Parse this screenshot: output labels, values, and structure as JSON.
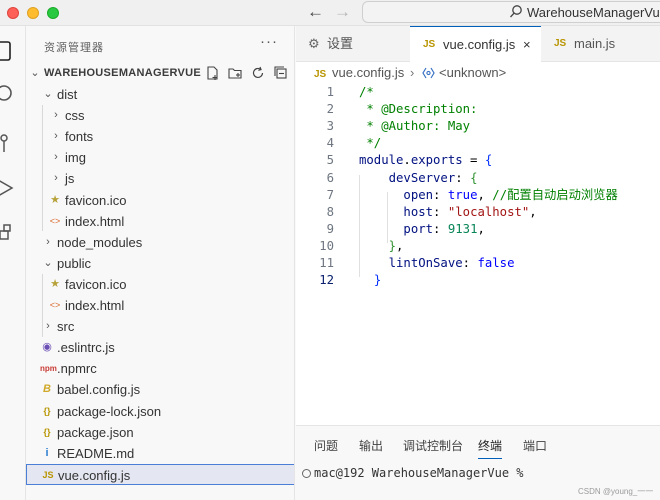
{
  "titlebar": {
    "search_text": "WarehouseManagerVue"
  },
  "sidebar": {
    "title": "资源管理器",
    "more": "···",
    "root": "WAREHOUSEMANAGERVUE",
    "tree": [
      {
        "label": "dist",
        "kind": "folder-open"
      },
      {
        "label": "css",
        "kind": "folder"
      },
      {
        "label": "fonts",
        "kind": "folder"
      },
      {
        "label": "img",
        "kind": "folder"
      },
      {
        "label": "js",
        "kind": "folder"
      },
      {
        "label": "favicon.ico",
        "kind": "star-icon"
      },
      {
        "label": "index.html",
        "kind": "html-icon"
      },
      {
        "label": "node_modules",
        "kind": "folder"
      },
      {
        "label": "public",
        "kind": "folder-open"
      },
      {
        "label": "favicon.ico",
        "kind": "star-icon"
      },
      {
        "label": "index.html",
        "kind": "html-icon"
      },
      {
        "label": "src",
        "kind": "folder"
      },
      {
        "label": ".eslintrc.js",
        "kind": "eslint-icon"
      },
      {
        "label": ".npmrc",
        "kind": "npm-icon"
      },
      {
        "label": "babel.config.js",
        "kind": "babel-icon"
      },
      {
        "label": "package-lock.json",
        "kind": "json-icon"
      },
      {
        "label": "package.json",
        "kind": "json-icon"
      },
      {
        "label": "README.md",
        "kind": "info-icon"
      },
      {
        "label": "vue.config.js",
        "kind": "js-icon",
        "selected": true
      }
    ],
    "icon_text": {
      "json": "{}",
      "js": "JS",
      "npm": "npm",
      "info": "i",
      "babel": "B"
    }
  },
  "tabs": [
    {
      "label": "设置",
      "icon": "settings-icon"
    },
    {
      "label": "vue.config.js",
      "icon": "js-icon",
      "active": true,
      "close": "×"
    },
    {
      "label": "main.js",
      "icon": "js-icon"
    }
  ],
  "breadcrumb": {
    "file": "vue.config.js",
    "sep": "›",
    "symbol": "<unknown>"
  },
  "editor": {
    "lines": [
      {
        "n": "1",
        "tokens": [
          [
            "/*",
            "c-comment"
          ]
        ]
      },
      {
        "n": "2",
        "tokens": [
          [
            " * @Description:",
            "c-comment"
          ]
        ]
      },
      {
        "n": "3",
        "tokens": [
          [
            " * @Author: May",
            "c-comment"
          ]
        ]
      },
      {
        "n": "4",
        "tokens": [
          [
            " */",
            "c-comment"
          ]
        ]
      },
      {
        "n": "5",
        "tokens": [
          [
            "module",
            "c-prop"
          ],
          [
            ".",
            "c-plain"
          ],
          [
            "exports",
            "c-prop"
          ],
          [
            " = ",
            "c-plain"
          ],
          [
            "{",
            "c-br1"
          ]
        ]
      },
      {
        "n": "6",
        "tokens": [
          [
            "    devServer",
            "c-prop"
          ],
          [
            ": ",
            "c-plain"
          ],
          [
            "{",
            "c-br2"
          ]
        ]
      },
      {
        "n": "7",
        "tokens": [
          [
            "      open",
            "c-prop"
          ],
          [
            ": ",
            "c-plain"
          ],
          [
            "true",
            "c-kw"
          ],
          [
            ", ",
            "c-plain"
          ],
          [
            "//配置自动启动浏览器",
            "c-comment"
          ]
        ]
      },
      {
        "n": "8",
        "tokens": [
          [
            "      host",
            "c-prop"
          ],
          [
            ": ",
            "c-plain"
          ],
          [
            "\"localhost\"",
            "c-str"
          ],
          [
            ",",
            "c-plain"
          ]
        ]
      },
      {
        "n": "9",
        "tokens": [
          [
            "      port",
            "c-prop"
          ],
          [
            ": ",
            "c-plain"
          ],
          [
            "9131",
            "c-num"
          ],
          [
            ",",
            "c-plain"
          ]
        ]
      },
      {
        "n": "10",
        "tokens": [
          [
            "    ",
            "c-plain"
          ],
          [
            "}",
            "c-br2"
          ],
          [
            ",",
            "c-plain"
          ]
        ]
      },
      {
        "n": "11",
        "tokens": [
          [
            "    lintOnSave",
            "c-prop"
          ],
          [
            ": ",
            "c-plain"
          ],
          [
            "false",
            "c-kw"
          ]
        ]
      },
      {
        "n": "12",
        "tokens": [
          [
            "  ",
            "c-plain"
          ],
          [
            "}",
            "c-br1"
          ]
        ],
        "current": true
      }
    ]
  },
  "panel": {
    "tabs": [
      "问题",
      "输出",
      "调试控制台",
      "终端",
      "端口"
    ],
    "active_tab": "终端",
    "terminal_line": "mac@192 WarehouseManagerVue %"
  },
  "watermark": "CSDN @young_一一"
}
